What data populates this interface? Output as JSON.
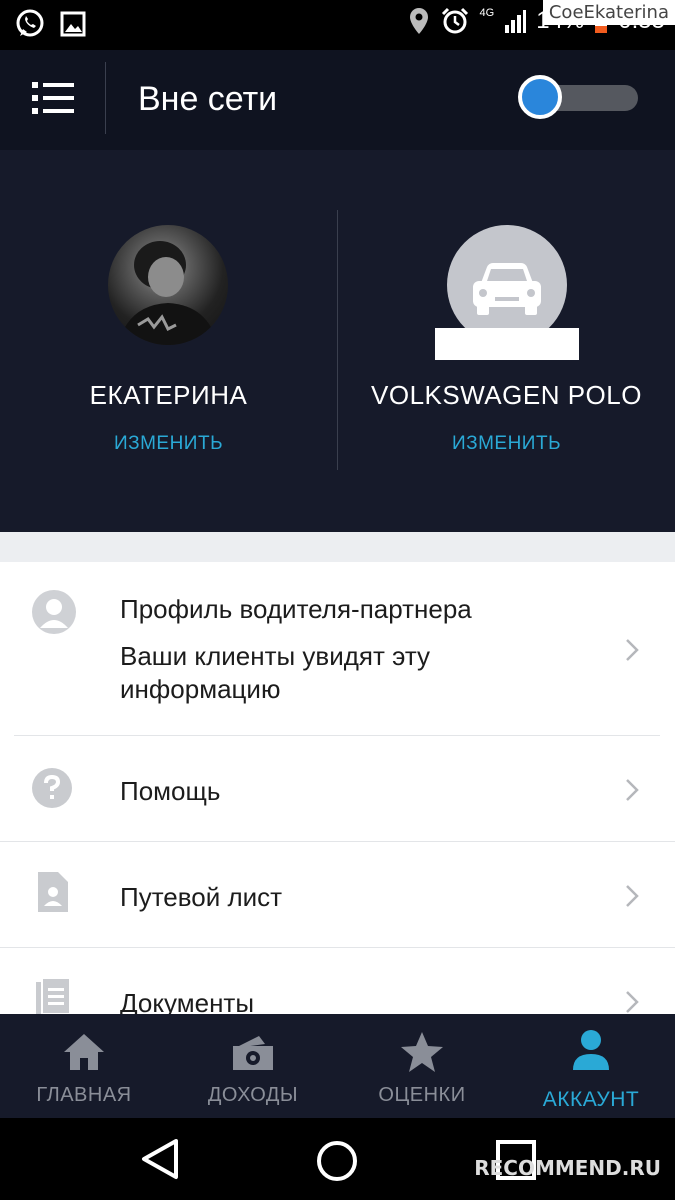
{
  "status_bar": {
    "battery_percent": "14%",
    "time": "0:55",
    "network": "4G",
    "watermark": "CoeEkaterina"
  },
  "header": {
    "title": "Вне сети",
    "online_toggle": false
  },
  "profile": {
    "driver": {
      "name": "ЕКАТЕРИНА",
      "edit_label": "ИЗМЕНИТЬ"
    },
    "vehicle": {
      "name": "VOLKSWAGEN POLO",
      "edit_label": "ИЗМЕНИТЬ"
    }
  },
  "menu": {
    "items": [
      {
        "title": "Профиль водителя-партнера",
        "subtitle": "Ваши клиенты увидят эту информацию",
        "icon": "user-circle-icon"
      },
      {
        "title": "Помощь",
        "icon": "help-icon"
      },
      {
        "title": "Путевой лист",
        "icon": "document-person-icon"
      },
      {
        "title": "Документы",
        "icon": "documents-icon"
      }
    ]
  },
  "tabs": [
    {
      "label": "ГЛАВНАЯ",
      "icon": "home-icon",
      "active": false
    },
    {
      "label": "ДОХОДЫ",
      "icon": "earnings-icon",
      "active": false
    },
    {
      "label": "ОЦЕНКИ",
      "icon": "star-icon",
      "active": false
    },
    {
      "label": "АККАУНТ",
      "icon": "account-icon",
      "active": true
    }
  ],
  "footer": {
    "watermark": "RECOMMEND.RU"
  },
  "colors": {
    "header_bg": "#0f1320",
    "profile_bg": "#161a2a",
    "accent": "#2aa9d6",
    "toggle_knob": "#2a86db"
  }
}
